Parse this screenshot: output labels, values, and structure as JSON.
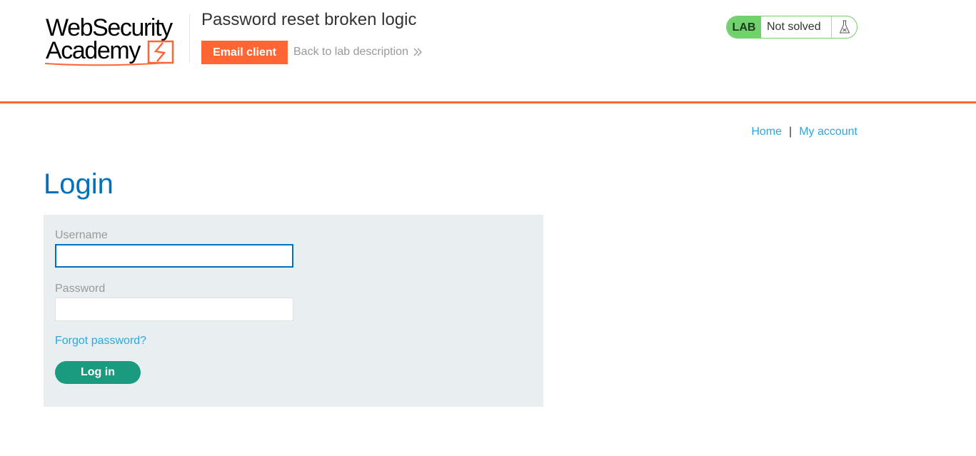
{
  "logo": {
    "line1": "WebSecurity",
    "line2": "Academy"
  },
  "header": {
    "lab_title": "Password reset broken logic",
    "email_client_label": "Email client",
    "back_link_label": "Back to lab description",
    "lab_badge": "LAB",
    "lab_status": "Not solved",
    "accent_color": "#ff6633",
    "status_color": "#70d16d"
  },
  "nav": {
    "home_label": "Home",
    "separator": "|",
    "my_account_label": "My account"
  },
  "main": {
    "page_title": "Login",
    "username_label": "Username",
    "username_value": "",
    "password_label": "Password",
    "password_value": "",
    "forgot_password_label": "Forgot password?",
    "login_button_label": "Log in",
    "login_button_color": "#1a9b80"
  },
  "icons": {
    "back_link": "double-chevron-right-icon",
    "lab_status": "flask-icon"
  }
}
